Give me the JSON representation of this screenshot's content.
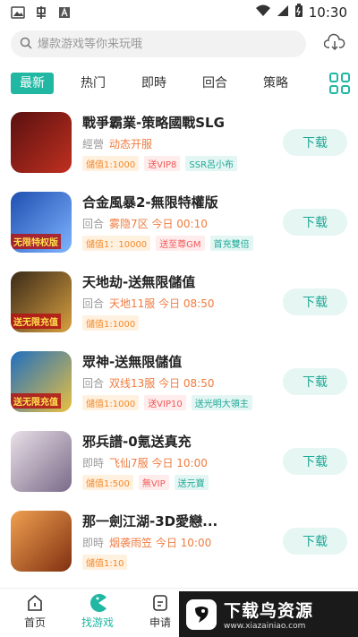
{
  "status_bar": {
    "time": "10:30"
  },
  "search": {
    "placeholder": "爆款游戏等你来玩哦"
  },
  "tabs": [
    {
      "label": "最新",
      "active": true
    },
    {
      "label": "热门"
    },
    {
      "label": "即時"
    },
    {
      "label": "回合"
    },
    {
      "label": "策略"
    }
  ],
  "games": [
    {
      "title": "戰爭霸業-策略國戰SLG",
      "category": "經營",
      "server": "动态开服",
      "tags": [
        {
          "text": "儲值1:1000",
          "style": "orange"
        },
        {
          "text": "送VIP8",
          "style": "red"
        },
        {
          "text": "SSR呂小布",
          "style": "teal"
        }
      ],
      "thumb_badge": "",
      "thumb_colors": [
        "#5a1010",
        "#c03020"
      ],
      "button": "下载"
    },
    {
      "title": "合金風暴2-無限特權版",
      "category": "回合",
      "server": "雾隐7区 今日 00:10",
      "tags": [
        {
          "text": "儲值1：10000",
          "style": "orange"
        },
        {
          "text": "送至尊GM",
          "style": "red"
        },
        {
          "text": "首充雙倍",
          "style": "teal"
        }
      ],
      "thumb_badge": "无限特权版",
      "thumb_colors": [
        "#1e4fb0",
        "#7fb4ff"
      ],
      "button": "下载"
    },
    {
      "title": "天地劫-送無限儲值",
      "category": "回合",
      "server": "天地11服 今日 08:50",
      "tags": [
        {
          "text": "儲值1:1000",
          "style": "orange"
        }
      ],
      "thumb_badge": "送无限充值",
      "thumb_colors": [
        "#3a2a18",
        "#d8a040"
      ],
      "button": "下载"
    },
    {
      "title": "眾神-送無限儲值",
      "category": "回合",
      "server": "双线13服 今日 08:50",
      "tags": [
        {
          "text": "儲值1:1000",
          "style": "orange"
        },
        {
          "text": "送VIP10",
          "style": "red"
        },
        {
          "text": "送光明大領主",
          "style": "teal"
        }
      ],
      "thumb_badge": "送无限充值",
      "thumb_colors": [
        "#1f6fc0",
        "#e8c040"
      ],
      "button": "下载"
    },
    {
      "title": "邪兵譜-0氪送真充",
      "category": "即時",
      "server": "飞仙7服 今日 10:00",
      "tags": [
        {
          "text": "儲值1:500",
          "style": "orange"
        },
        {
          "text": "無VIP",
          "style": "red"
        },
        {
          "text": "送元寶",
          "style": "teal"
        }
      ],
      "thumb_badge": "",
      "thumb_colors": [
        "#e8e0e8",
        "#7a6a88"
      ],
      "button": "下载"
    },
    {
      "title": "那一劍江湖-3D愛戀...",
      "category": "即時",
      "server": "烟袭雨笠 今日 10:00",
      "tags": [
        {
          "text": "儲值1:10",
          "style": "orange"
        }
      ],
      "thumb_badge": "",
      "thumb_colors": [
        "#f0a050",
        "#803010"
      ],
      "button": "下载"
    }
  ],
  "bottom_nav": [
    {
      "label": "首页",
      "icon": "home-icon",
      "active": false
    },
    {
      "label": "找游戏",
      "icon": "pacman-icon",
      "active": true
    },
    {
      "label": "申请",
      "icon": "apply-icon",
      "active": false
    }
  ],
  "watermark": {
    "title": "下载鸟资源",
    "url": "www.xiazainiao.com"
  },
  "colors": {
    "accent": "#20b7a3"
  }
}
